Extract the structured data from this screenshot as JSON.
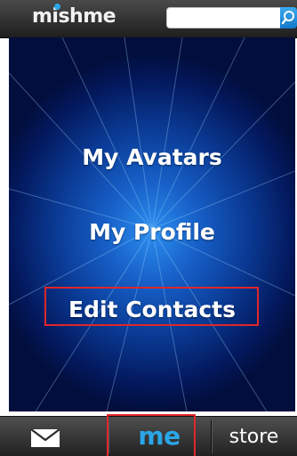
{
  "header": {
    "logo_text": "mishme",
    "search_value": "",
    "search_icon": "search-icon"
  },
  "menu": {
    "items": [
      {
        "label": "My Avatars"
      },
      {
        "label": "My Profile"
      },
      {
        "label": "Edit Contacts"
      }
    ]
  },
  "tabbar": {
    "mail_icon": "mail-icon",
    "me_label": "me",
    "store_label": "store"
  },
  "colors": {
    "accent": "#2aa6e8",
    "highlight": "#e0262a",
    "panel_blue": "#1760c8"
  }
}
